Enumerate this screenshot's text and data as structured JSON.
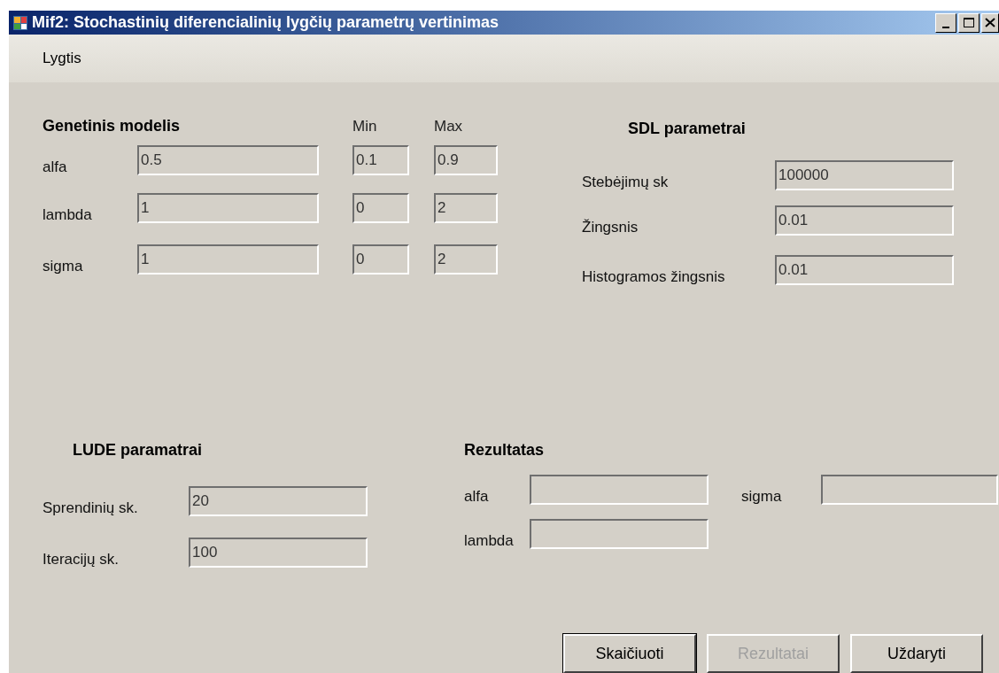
{
  "window": {
    "title": "Mif2: Stochastinių diferencialinių lygčių parametrų vertinimas"
  },
  "menu": [
    {
      "label": "Lygtis"
    }
  ],
  "genetic_model": {
    "title": "Genetinis modelis",
    "min_header": "Min",
    "max_header": "Max",
    "rows": [
      {
        "label": "alfa",
        "value": "0.5",
        "min": "0.1",
        "max": "0.9"
      },
      {
        "label": "lambda",
        "value": "1",
        "min": "0",
        "max": "2"
      },
      {
        "label": "sigma",
        "value": "1",
        "min": "0",
        "max": "2"
      }
    ]
  },
  "sdl_parameters": {
    "title": "SDL parametrai",
    "rows": [
      {
        "label": "Stebėjimų sk",
        "value": "100000"
      },
      {
        "label": "Žingsnis",
        "value": "0.01"
      },
      {
        "label": "Histogramos žingsnis",
        "value": "0.01"
      }
    ]
  },
  "lude_parameters": {
    "title": "LUDE paramatrai",
    "rows": [
      {
        "label": "Sprendinių sk.",
        "value": "20"
      },
      {
        "label": "Iteracijų sk.",
        "value": "100"
      }
    ]
  },
  "result": {
    "title": "Rezultatas",
    "fields": [
      {
        "label": "alfa"
      },
      {
        "label": "sigma"
      },
      {
        "label": "lambda"
      }
    ]
  },
  "buttons": [
    {
      "label": "Skaičiuoti",
      "disabled": false,
      "default": true
    },
    {
      "label": "Rezultatai",
      "disabled": true,
      "default": false
    },
    {
      "label": "Uždaryti",
      "disabled": false,
      "default": false
    }
  ]
}
